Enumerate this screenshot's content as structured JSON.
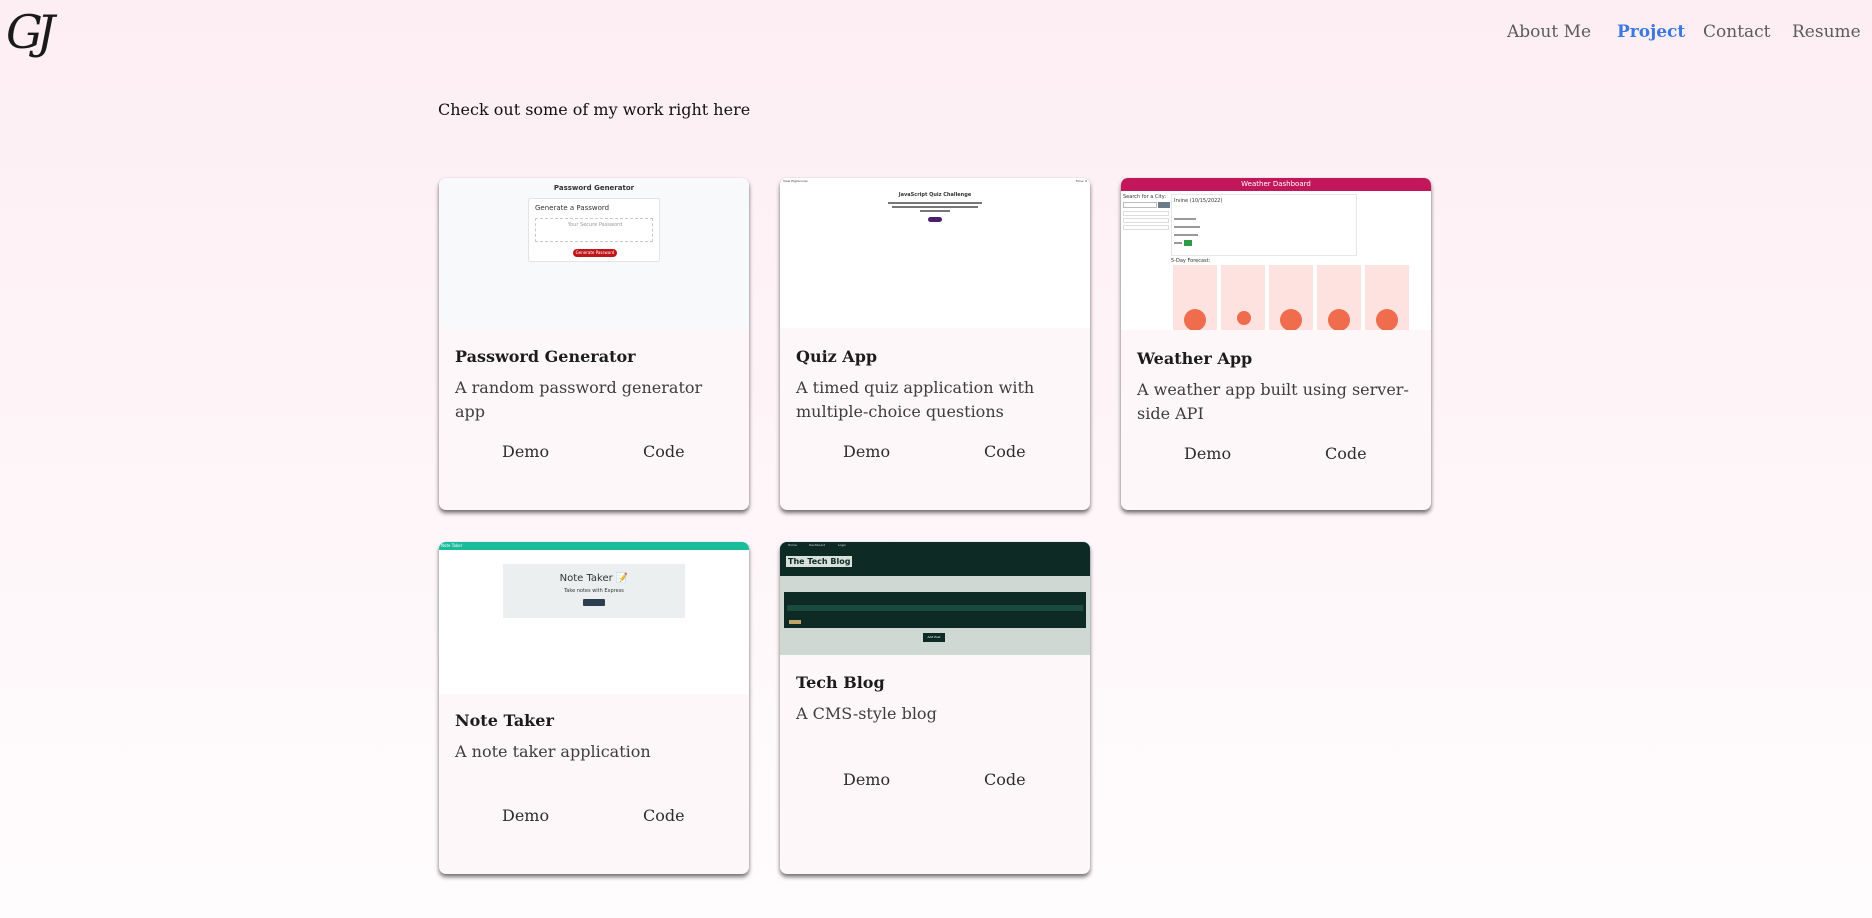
{
  "header": {
    "logo": "GJ",
    "nav": [
      {
        "label": "About Me",
        "active": false
      },
      {
        "label": "Project",
        "active": true
      },
      {
        "label": "Contact",
        "active": false
      },
      {
        "label": "Resume",
        "active": false
      }
    ]
  },
  "intro": "Check out some of my work right here",
  "projects": [
    {
      "title": "Password Generator",
      "description": "A random password generator app",
      "demo_label": "Demo",
      "code_label": "Code",
      "thumbnail": {
        "heading": "Password Generator",
        "card_title": "Generate a Password",
        "placeholder": "Your Secure Password",
        "button": "Generate Password"
      }
    },
    {
      "title": "Quiz App",
      "description": "A timed quiz application with multiple-choice questions",
      "demo_label": "Demo",
      "code_label": "Code",
      "thumbnail": {
        "corner_left": "View Highscores",
        "corner_right": "Time: 0",
        "heading": "JavaScript Quiz Challenge",
        "button": "Start Quiz"
      }
    },
    {
      "title": "Weather App",
      "description": "A weather app built using server-side API",
      "demo_label": "Demo",
      "code_label": "Code",
      "thumbnail": {
        "banner": "Weather Dashboard",
        "search_label": "Search for a City:",
        "search_button": "Search",
        "city_heading": "Irvine (10/15/2022)",
        "forecast_label": "5-Day Forecast:"
      }
    },
    {
      "title": "Note Taker",
      "description": "A note taker application",
      "demo_label": "Demo",
      "code_label": "Code",
      "thumbnail": {
        "corner_label": "Note Taker",
        "heading": "Note Taker 📝",
        "subheading": "Take notes with Express",
        "button": "Get Started"
      }
    },
    {
      "title": "Tech Blog",
      "description": "A CMS-style blog",
      "demo_label": "Demo",
      "code_label": "Code",
      "thumbnail": {
        "nav": [
          "Home",
          "Dashboard",
          "Login"
        ],
        "heading": "The Tech Blog",
        "button": "Add Post"
      }
    }
  ],
  "colors": {
    "nav_active": "#3b78e0",
    "weather_banner": "#c2185b",
    "note_banner": "#1abc9c",
    "blog_dark": "#0d2a24",
    "forecast_card": "#fde2df",
    "forecast_sun": "#ef6c4d"
  }
}
